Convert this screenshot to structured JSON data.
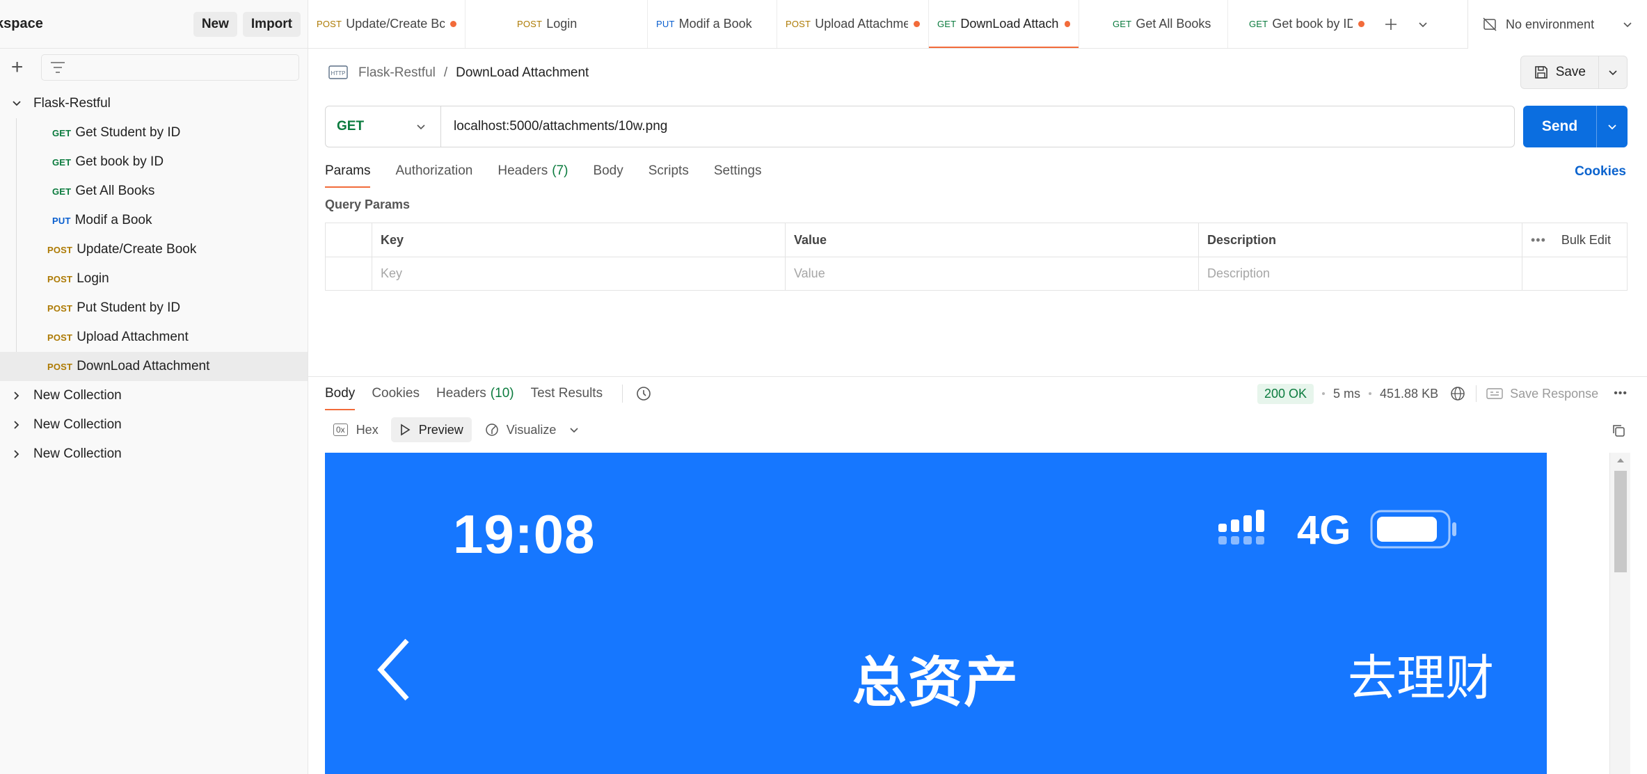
{
  "sidebar": {
    "workspace_name": "kspace",
    "new_label": "New",
    "import_label": "Import",
    "collection": {
      "name": "Flask-Restful",
      "items": [
        {
          "method": "GET",
          "label": "Get Student by ID"
        },
        {
          "method": "GET",
          "label": "Get book by ID"
        },
        {
          "method": "GET",
          "label": "Get All Books"
        },
        {
          "method": "PUT",
          "label": "Modif a Book"
        },
        {
          "method": "POST",
          "label": "Update/Create Book"
        },
        {
          "method": "POST",
          "label": "Login"
        },
        {
          "method": "POST",
          "label": "Put Student by ID"
        },
        {
          "method": "POST",
          "label": "Upload Attachment"
        },
        {
          "method": "POST",
          "label": "DownLoad Attachment"
        }
      ]
    },
    "other_collections": [
      "New Collection",
      "New Collection",
      "New Collection"
    ]
  },
  "tabs": [
    {
      "method": "POST",
      "label": "Update/Create Bc",
      "unsaved": true
    },
    {
      "method": "POST",
      "label": "Login",
      "unsaved": false
    },
    {
      "method": "PUT",
      "label": "Modif a Book",
      "unsaved": false
    },
    {
      "method": "POST",
      "label": "Upload Attachme",
      "unsaved": true
    },
    {
      "method": "GET",
      "label": "DownLoad Attachn",
      "unsaved": true,
      "active": true
    },
    {
      "method": "GET",
      "label": "Get All Books",
      "unsaved": false
    },
    {
      "method": "GET",
      "label": "Get book by ID",
      "unsaved": true
    }
  ],
  "environment": {
    "label": "No environment"
  },
  "request": {
    "breadcrumb_parent": "Flask-Restful",
    "breadcrumb_sep": "/",
    "breadcrumb_current": "DownLoad Attachment",
    "save_label": "Save",
    "method": "GET",
    "url": "localhost:5000/attachments/10w.png",
    "send_label": "Send",
    "tabs": [
      {
        "label": "Params",
        "count": ""
      },
      {
        "label": "Authorization",
        "count": ""
      },
      {
        "label": "Headers",
        "count": "(7)"
      },
      {
        "label": "Body",
        "count": ""
      },
      {
        "label": "Scripts",
        "count": ""
      },
      {
        "label": "Settings",
        "count": ""
      }
    ],
    "cookies_label": "Cookies",
    "query_params": {
      "title": "Query Params",
      "headers": [
        "Key",
        "Value",
        "Description"
      ],
      "bulk_edit": "Bulk Edit",
      "placeholders": [
        "Key",
        "Value",
        "Description"
      ]
    }
  },
  "response": {
    "tabs": [
      {
        "label": "Body",
        "count": ""
      },
      {
        "label": "Cookies",
        "count": ""
      },
      {
        "label": "Headers",
        "count": "(10)"
      },
      {
        "label": "Test Results",
        "count": ""
      }
    ],
    "status": "200 OK",
    "time": "5 ms",
    "size": "451.88 KB",
    "save_response": "Save Response",
    "view_options": [
      "Hex",
      "Preview",
      "Visualize"
    ],
    "hex_badge": "0x",
    "preview_image": {
      "time": "19:08",
      "network": "4G",
      "title": "总资产",
      "right_action": "去理财",
      "background": "#1677ff"
    }
  },
  "colors": {
    "accent": "#f26b3a",
    "send": "#0b6ee0",
    "get": "#0b7b3e",
    "put": "#0a5fcf",
    "post": "#ad7a03"
  }
}
